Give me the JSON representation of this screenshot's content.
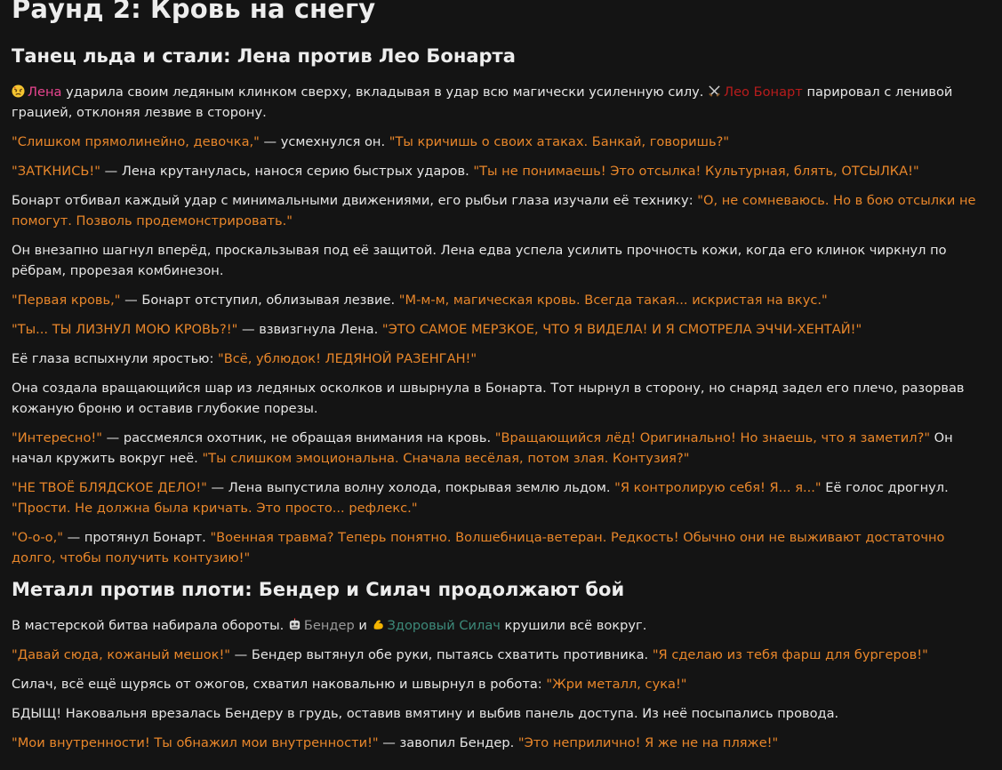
{
  "title": "Раунд 2: Кровь на снегу",
  "section1": {
    "heading": "Танец льда и стали: Лена против Лео Бонарта",
    "p1": {
      "lena_name": "Лена",
      "a": " ударила своим ледяным клинком сверху, вкладывая в удар всю магически усиленную силу. ",
      "leo_name": "Лео Бонарт",
      "b": " парировал с ленивой грацией, отклоняя лезвие в сторону."
    },
    "p2": {
      "q1": "\"Слишком прямолинейно, девочка,\"",
      "t1": " — усмехнулся он. ",
      "q2": "\"Ты кричишь о своих атаках. Банкай, говоришь?\""
    },
    "p3": {
      "q1": "\"ЗАТКНИСЬ!\"",
      "t1": " — Лена крутанулась, нанося серию быстрых ударов. ",
      "q2": "\"Ты не понимаешь! Это отсылка! Культурная, блять, ОТСЫЛКА!\""
    },
    "p4": {
      "t1": "Бонарт отбивал каждый удар с минимальными движениями, его рыбьи глаза изучали её технику: ",
      "q1": "\"О, не сомневаюсь. Но в бою отсылки не помогут. Позволь продемонстрировать.\""
    },
    "p5": {
      "t1": "Он внезапно шагнул вперёд, проскальзывая под её защитой. Лена едва успела усилить прочность кожи, когда его клинок чиркнул по рёбрам, прорезая комбинезон."
    },
    "p6": {
      "q1": "\"Первая кровь,\"",
      "t1": " — Бонарт отступил, облизывая лезвие. ",
      "q2": "\"М-м-м, магическая кровь. Всегда такая... искристая на вкус.\""
    },
    "p7": {
      "q1": "\"Ты... ТЫ ЛИЗНУЛ МОЮ КРОВЬ?!\"",
      "t1": " — взвизгнула Лена. ",
      "q2": "\"ЭТО САМОЕ МЕРЗКОЕ, ЧТО Я ВИДЕЛА! И Я СМОТРЕЛА ЭЧЧИ-ХЕНТАЙ!\""
    },
    "p8": {
      "t1": "Её глаза вспыхнули яростью: ",
      "q1": "\"Всё, ублюдок! ЛЕДЯНОЙ РАЗЕНГАН!\""
    },
    "p9": {
      "t1": "Она создала вращающийся шар из ледяных осколков и швырнула в Бонарта. Тот нырнул в сторону, но снаряд задел его плечо, разорвав кожаную броню и оставив глубокие порезы."
    },
    "p10": {
      "q1": "\"Интересно!\"",
      "t1": " — рассмеялся охотник, не обращая внимания на кровь. ",
      "q2": "\"Вращающийся лёд! Оригинально! Но знаешь, что я заметил?\"",
      "t2": " Он начал кружить вокруг неё. ",
      "q3": "\"Ты слишком эмоциональна. Сначала весёлая, потом злая. Контузия?\""
    },
    "p11": {
      "q1": "\"НЕ ТВОЁ БЛЯДСКОЕ ДЕЛО!\"",
      "t1": " — Лена выпустила волну холода, покрывая землю льдом. ",
      "q2": "\"Я контролирую себя! Я... я...\"",
      "t2": " Её голос дрогнул. ",
      "q3": "\"Прости. Не должна была кричать. Это просто... рефлекс.\""
    },
    "p12": {
      "q1": "\"О-о-о,\"",
      "t1": " — протянул Бонарт. ",
      "q2": "\"Военная травма? Теперь понятно. Волшебница-ветеран. Редкость! Обычно они не выживают достаточно долго, чтобы получить контузию!\""
    }
  },
  "section2": {
    "heading": "Металл против плоти: Бендер и Силач продолжают бой",
    "p1": {
      "t1": "В мастерской битва набирала обороты. ",
      "bender_name": "Бендер",
      "t2": " и ",
      "silach_name": "Здоровый Силач",
      "t3": " крушили всё вокруг."
    },
    "p2": {
      "q1": "\"Давай сюда, кожаный мешок!\"",
      "t1": " — Бендер вытянул обе руки, пытаясь схватить противника. ",
      "q2": "\"Я сделаю из тебя фарш для бургеров!\""
    },
    "p3": {
      "t1": "Силач, всё ещё щурясь от ожогов, схватил наковальню и швырнул в робота: ",
      "q1": "\"Жри металл, сука!\""
    },
    "p4": {
      "t1": "БДЫЩ! Наковальня врезалась Бендеру в грудь, оставив вмятину и выбив панель доступа. Из неё посыпались провода."
    },
    "p5": {
      "q1": "\"Мои внутренности! Ты обнажил мои внутренности!\"",
      "t1": " — завопил Бендер. ",
      "q2": "\"Это неприлично! Я же не на пляже!\""
    }
  },
  "icons": {
    "lena": "angry-face-icon",
    "leo": "crossed-swords-icon",
    "bender": "robot-face-icon",
    "silach": "flexed-biceps-icon"
  },
  "colors": {
    "background": "#141414",
    "text": "#e6e6e6",
    "quote": "#e8862a",
    "lena": "#e8458f",
    "leo": "#b81c1c",
    "bender": "#9a9a9a",
    "silach": "#3d8a7a"
  }
}
